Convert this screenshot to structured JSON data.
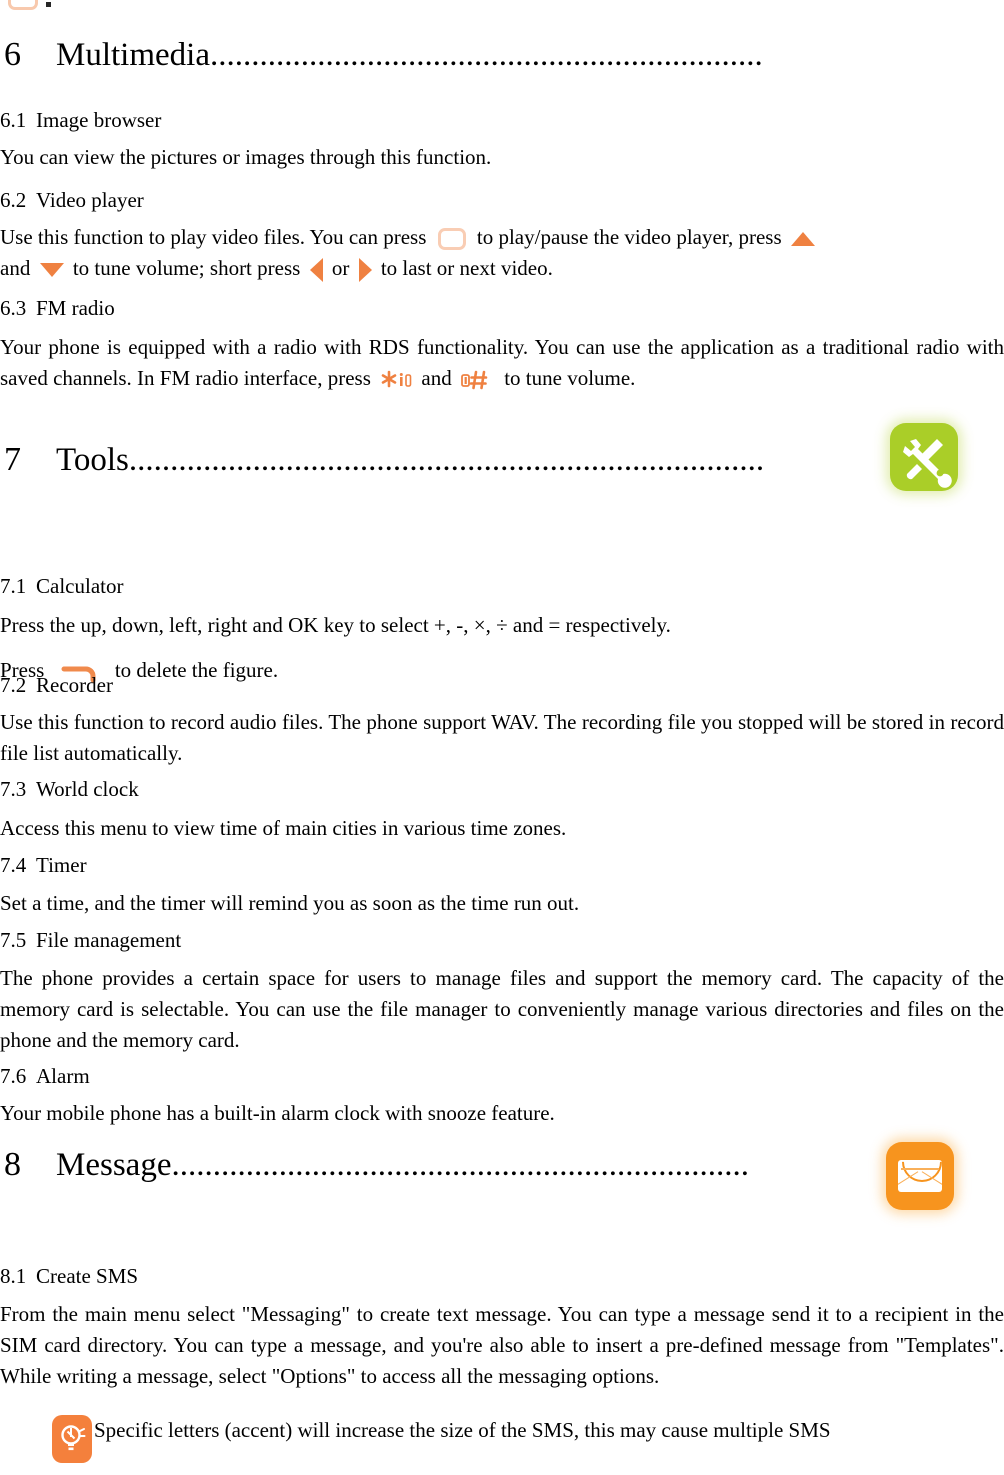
{
  "document": {
    "type": "mobile-phone-user-manual-page",
    "accent_orange": "#ef8141",
    "icon_green": "#aace28",
    "icon_orange": "#f7941e"
  },
  "chapters": [
    {
      "number": "6",
      "title": "Multimedia",
      "leader": "...................................................................",
      "icon": null
    },
    {
      "number": "7",
      "title": "Tools",
      "leader": ".............................................................................",
      "icon": "tools-icon"
    },
    {
      "number": "8",
      "title": "Message",
      "leader": "......................................................................",
      "icon": "message-icon"
    }
  ],
  "sections": [
    {
      "num": "6.1",
      "title": "Image browser"
    },
    {
      "num": "6.2",
      "title": "Video player"
    },
    {
      "num": "6.3",
      "title": "FM radio"
    },
    {
      "num": "7.1",
      "title": "Calculator"
    },
    {
      "num": "7.2",
      "title": "Recorder"
    },
    {
      "num": "7.3",
      "title": "World clock"
    },
    {
      "num": "7.4",
      "title": "Timer"
    },
    {
      "num": "7.5",
      "title": "File management"
    },
    {
      "num": "7.6",
      "title": "Alarm"
    },
    {
      "num": "8.1",
      "title": "Create SMS"
    }
  ],
  "paragraphs": {
    "image_browser": "You can view the pictures or images through this function.",
    "video_player_1a": "Use this function to play video files. You can press",
    "video_player_1b": "to play/pause the video player, press",
    "video_player_2a": "and",
    "video_player_2b": "to tune volume; short press",
    "video_player_2c": "or",
    "video_player_2d": "to last or next video.",
    "fm_radio_a": "Your phone is equipped with a radio with RDS functionality. You can use the application as a traditional radio with saved channels. In FM radio interface, press",
    "fm_radio_b": "and",
    "fm_radio_c": "to tune volume.",
    "calculator_1": "Press the up, down, left, right and OK key to select +, -, ×, ÷ and = respectively.",
    "calculator_2a": "Press",
    "calculator_2b": "to delete the figure.",
    "recorder": "Use this function to record audio files. The phone support WAV. The recording file you stopped will be stored in record file list automatically.",
    "world_clock": "Access this menu to view time of main cities in various time zones.",
    "timer": "Set a time, and the timer will remind you as soon as the time run out.",
    "file_management": "The phone provides a certain space for users to manage files and support the memory card. The capacity of the memory card is selectable. You can use the file manager to conveniently manage various directories and files on the phone and the memory card.",
    "alarm": "Your mobile phone has a built-in alarm clock with snooze feature.",
    "create_sms": "From the main menu select \"Messaging\" to create text message. You can type a message send it to a recipient in the SIM card directory. You can type a message, and you're also able to insert a pre-defined message from \"Templates\". While writing a message, select \"Options\" to access all the messaging options.",
    "tip_sms": "Specific letters (accent) will increase the size of the SMS, this may cause multiple SMS"
  }
}
